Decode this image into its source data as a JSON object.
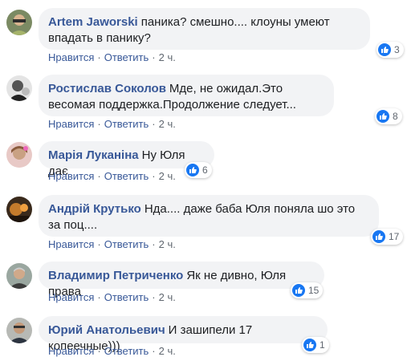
{
  "colors": {
    "author": "#385898",
    "bubble": "#f2f3f5",
    "like": "#1877f2",
    "meta": "#606770"
  },
  "labels": {
    "like": "Нравится",
    "reply": "Ответить",
    "separator": "·"
  },
  "comments": [
    {
      "author": "Artem Jaworski",
      "text": "паника? смешно.... клоуны умеют впадать в панику?",
      "time": "2 ч.",
      "likes": "3",
      "avatar": "avatar-photo-1"
    },
    {
      "author": "Ростислав Соколов",
      "text": "Мде, не ожидал.Это весомая поддержка.Продолжение следует...",
      "time": "2 ч.",
      "likes": "8",
      "avatar": "avatar-photo-2"
    },
    {
      "author": "Марія Луканіна",
      "text": "Ну Юля дає",
      "time": "2 ч.",
      "likes": "6",
      "avatar": "avatar-photo-3"
    },
    {
      "author": "Андрій Крутько",
      "text": "Нда.... даже баба Юля поняла шо это за поц....",
      "time": "2 ч.",
      "likes": "17",
      "avatar": "avatar-photo-4"
    },
    {
      "author": "Владимир Петриченко",
      "text": "Як не дивно, Юля права",
      "time": "2 ч.",
      "likes": "15",
      "avatar": "avatar-photo-5"
    },
    {
      "author": "Юрий Анатольевич",
      "text": "И зашипели 17 копеечные)))",
      "time": "2 ч.",
      "likes": "1",
      "avatar": "avatar-photo-6"
    }
  ]
}
